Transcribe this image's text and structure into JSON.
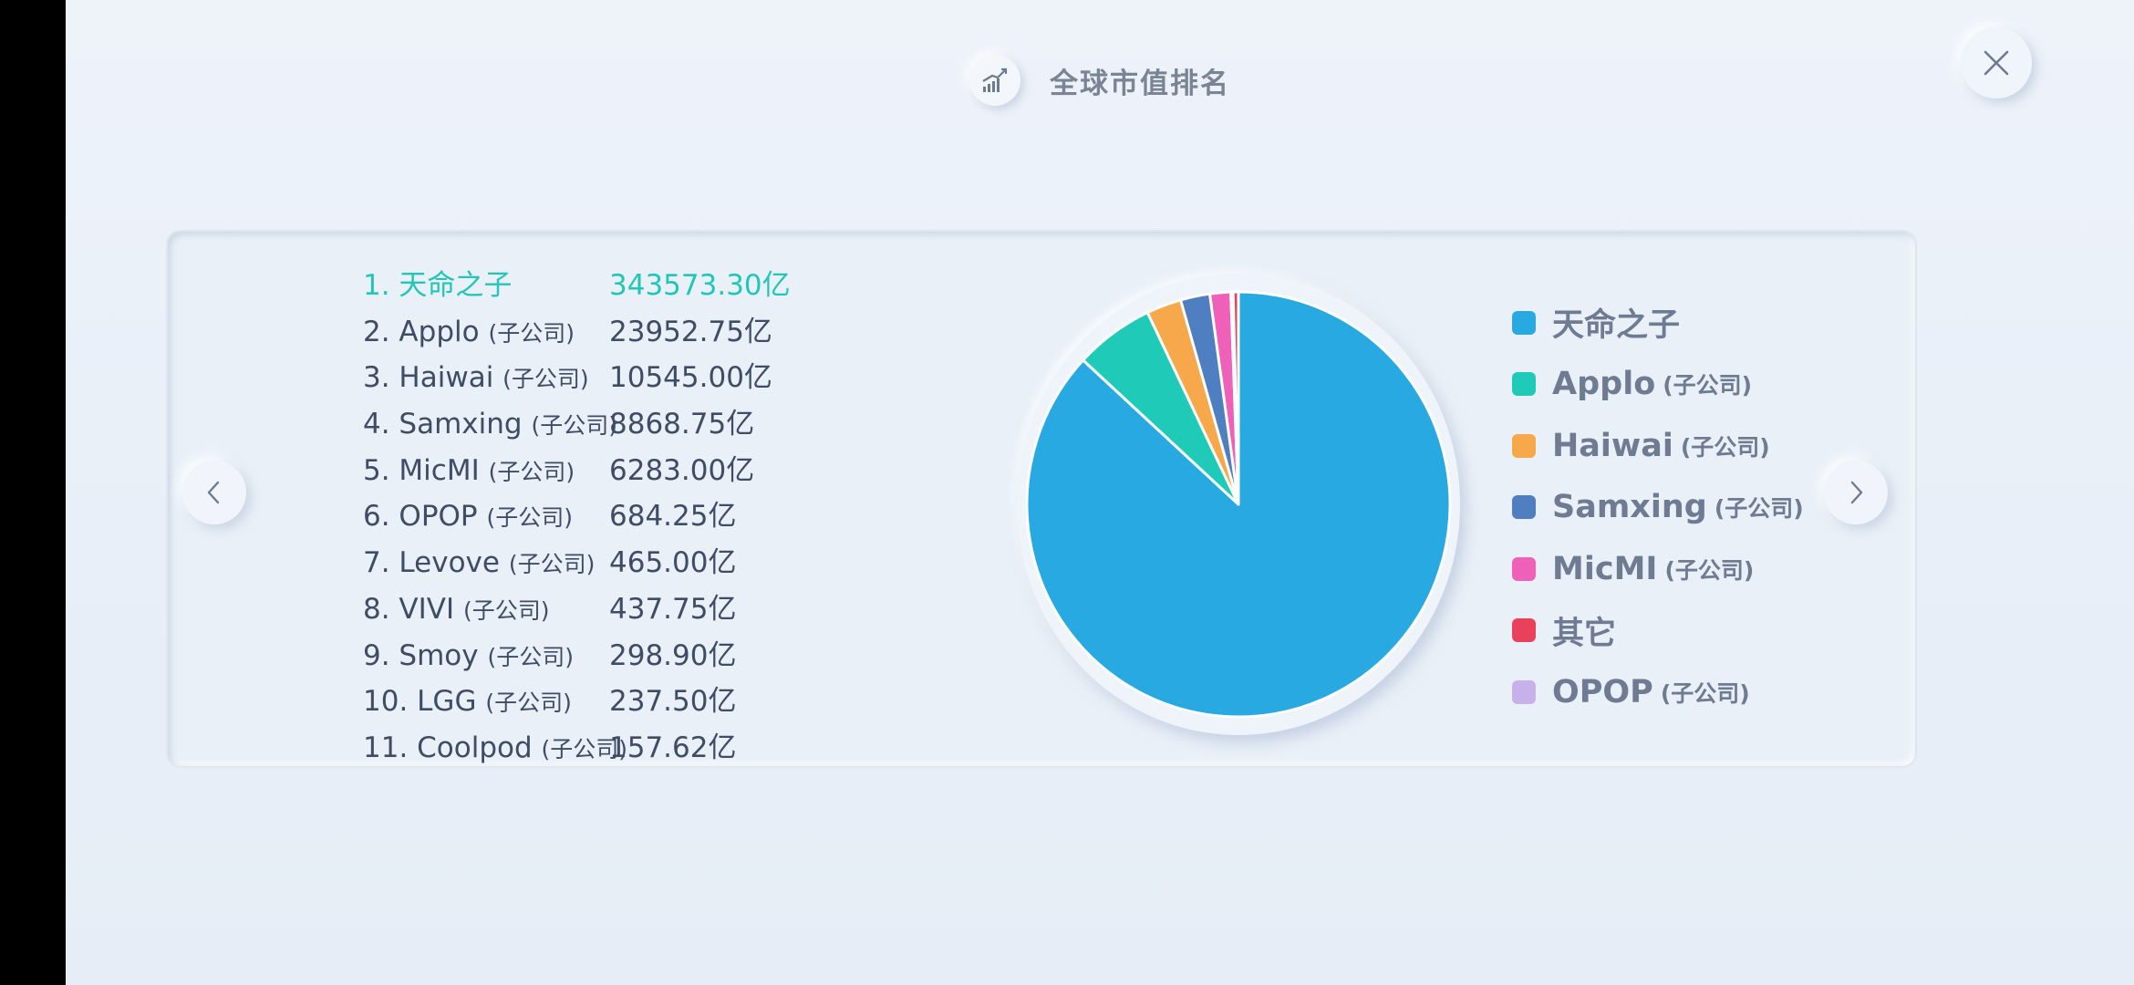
{
  "header": {
    "title": "全球市值排名",
    "icon": "chart-trend-up-icon"
  },
  "ranking": [
    {
      "name": "1. 天命之子",
      "sub": "",
      "value": "343573.30亿"
    },
    {
      "name": "2. Applo ",
      "sub": "(子公司)",
      "value": "23952.75亿"
    },
    {
      "name": "3. Haiwai ",
      "sub": "(子公司)",
      "value": "10545.00亿"
    },
    {
      "name": "4. Samxing ",
      "sub": "(子公司)",
      "value": "8868.75亿"
    },
    {
      "name": "5. MicMI ",
      "sub": "(子公司)",
      "value": "6283.00亿"
    },
    {
      "name": "6. OPOP ",
      "sub": "(子公司)",
      "value": "684.25亿"
    },
    {
      "name": "7. Levove ",
      "sub": "(子公司)",
      "value": "465.00亿"
    },
    {
      "name": "8. VIVI ",
      "sub": "(子公司)",
      "value": "437.75亿"
    },
    {
      "name": "9. Smoy ",
      "sub": "(子公司)",
      "value": "298.90亿"
    },
    {
      "name": "10. LGG ",
      "sub": "(子公司)",
      "value": "237.50亿"
    },
    {
      "name": "11. Coolpod ",
      "sub": "(子公司)",
      "value": "157.62亿"
    }
  ],
  "colors": {
    "highlight": "#22c6b8",
    "text": "#3f4c66",
    "legend_text": "#6e7b92"
  },
  "legend": [
    {
      "name": "天命之子",
      "sub": "",
      "color": "#29a9e1"
    },
    {
      "name": "Applo",
      "sub": "(子公司)",
      "color": "#1fcbb8"
    },
    {
      "name": "Haiwai",
      "sub": "(子公司)",
      "color": "#f6a84a"
    },
    {
      "name": "Samxing",
      "sub": "(子公司)",
      "color": "#4f7fc0"
    },
    {
      "name": "MicMI",
      "sub": "(子公司)",
      "color": "#ef61b9"
    },
    {
      "name": "其它",
      "sub": "",
      "color": "#e9415b"
    },
    {
      "name": "OPOP",
      "sub": "(子公司)",
      "color": "#c6b1ea"
    }
  ],
  "chart_data": {
    "type": "pie",
    "labels": [
      "天命之子",
      "Applo",
      "Haiwai",
      "Samxing",
      "MicMI",
      "OPOP",
      "其它"
    ],
    "values": [
      343573.3,
      23952.75,
      10545.0,
      8868.75,
      6283.0,
      684.25,
      1596.77
    ],
    "colors": [
      "#29a9e1",
      "#1fcbb8",
      "#f6a84a",
      "#4f7fc0",
      "#ef61b9",
      "#c6b1ea",
      "#e9415b"
    ],
    "legend_position": "right"
  }
}
